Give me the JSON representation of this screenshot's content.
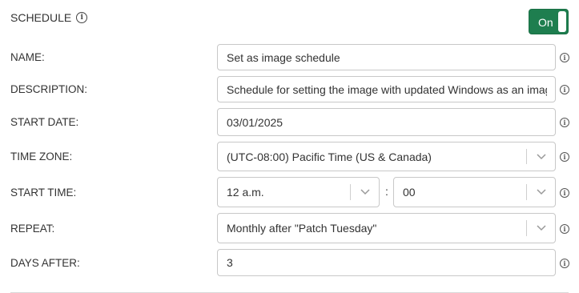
{
  "section": {
    "title": "SCHEDULE",
    "toggle_label": "On"
  },
  "form": {
    "name_label": "NAME:",
    "name_value": "Set as image schedule",
    "description_label": "DESCRIPTION:",
    "description_value": "Schedule for setting the image with updated Windows as an image",
    "start_date_label": "START DATE:",
    "start_date_value": "03/01/2025",
    "time_zone_label": "TIME ZONE:",
    "time_zone_value": "(UTC-08:00) Pacific Time (US & Canada)",
    "start_time_label": "START TIME:",
    "start_time_hour": "12 a.m.",
    "start_time_separator": ":",
    "start_time_minute": "00",
    "repeat_label": "REPEAT:",
    "repeat_value": "Monthly after \"Patch Tuesday\"",
    "days_after_label": "DAYS AFTER:",
    "days_after_value": "3"
  },
  "icons": {
    "info": "info-icon",
    "dropdown": "chevron-down-icon"
  },
  "colors": {
    "toggle_on": "#1e7e4f",
    "border": "#c8c8c8"
  }
}
